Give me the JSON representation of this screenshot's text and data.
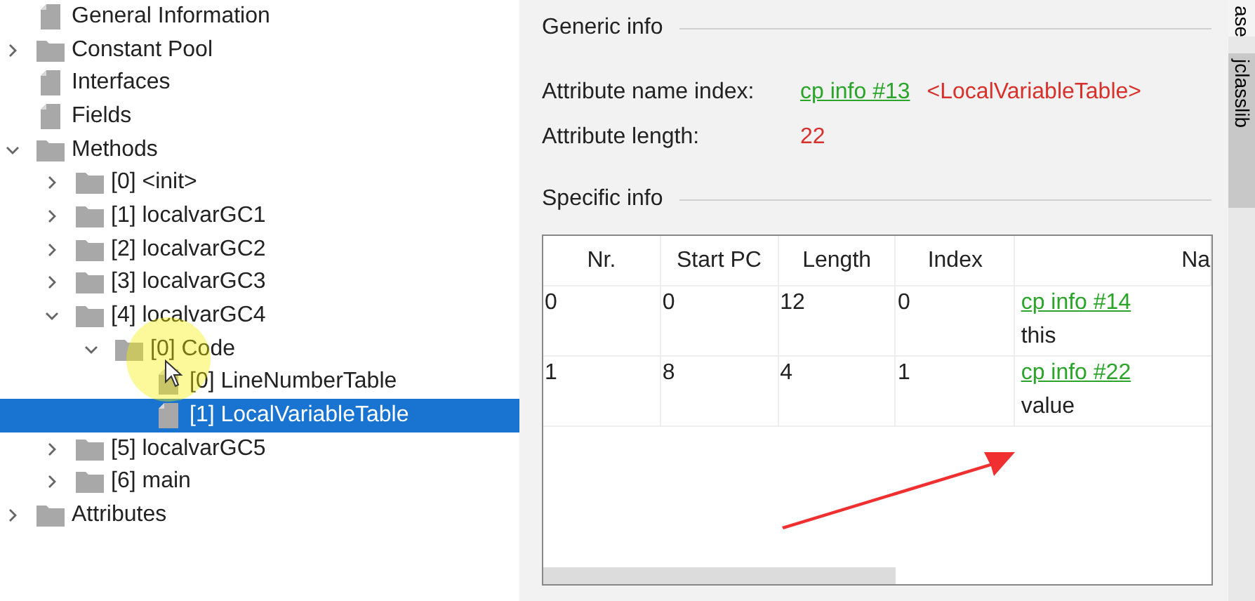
{
  "tree": [
    {
      "label": "General Information",
      "kind": "file",
      "selected": false
    },
    {
      "label": "Constant Pool",
      "kind": "folder",
      "expanded": false,
      "selected": false
    },
    {
      "label": "Interfaces",
      "kind": "file",
      "selected": false
    },
    {
      "label": "Fields",
      "kind": "file",
      "selected": false
    },
    {
      "label": "Methods",
      "kind": "folder",
      "expanded": true,
      "selected": false,
      "children": [
        {
          "label": "[0] <init>",
          "kind": "folder",
          "expanded": false,
          "selected": false
        },
        {
          "label": "[1] localvarGC1",
          "kind": "folder",
          "expanded": false,
          "selected": false
        },
        {
          "label": "[2] localvarGC2",
          "kind": "folder",
          "expanded": false,
          "selected": false
        },
        {
          "label": "[3] localvarGC3",
          "kind": "folder",
          "expanded": false,
          "selected": false
        },
        {
          "label": "[4] localvarGC4",
          "kind": "folder",
          "expanded": true,
          "selected": false,
          "children": [
            {
              "label": "[0] Code",
              "kind": "folder",
              "expanded": true,
              "selected": false,
              "children": [
                {
                  "label": "[0] LineNumberTable",
                  "kind": "file",
                  "selected": false
                },
                {
                  "label": "[1] LocalVariableTable",
                  "kind": "file",
                  "selected": true
                }
              ]
            }
          ]
        },
        {
          "label": "[5] localvarGC5",
          "kind": "folder",
          "expanded": false,
          "selected": false
        },
        {
          "label": "[6] main",
          "kind": "folder",
          "expanded": false,
          "selected": false
        }
      ]
    },
    {
      "label": "Attributes",
      "kind": "folder",
      "expanded": false,
      "selected": false
    }
  ],
  "generic_info": {
    "title": "Generic info",
    "fields": [
      {
        "label": "Attribute name index:",
        "link": "cp info #13",
        "value": "<LocalVariableTable>"
      },
      {
        "label": "Attribute length:",
        "value": "22"
      }
    ]
  },
  "specific_info": {
    "title": "Specific info",
    "table": {
      "columns": [
        "Nr.",
        "Start PC",
        "Length",
        "Index",
        "Na"
      ],
      "rows": [
        {
          "cells": [
            "0",
            "0",
            "12",
            "0"
          ],
          "name_link": "cp info #14",
          "name": "this"
        },
        {
          "cells": [
            "1",
            "8",
            "4",
            "1"
          ],
          "name_link": "cp info #22",
          "name": "value"
        }
      ]
    }
  },
  "side_tabs": [
    {
      "label": "ase",
      "selected": false
    },
    {
      "label": "jclasslib",
      "selected": true
    }
  ]
}
